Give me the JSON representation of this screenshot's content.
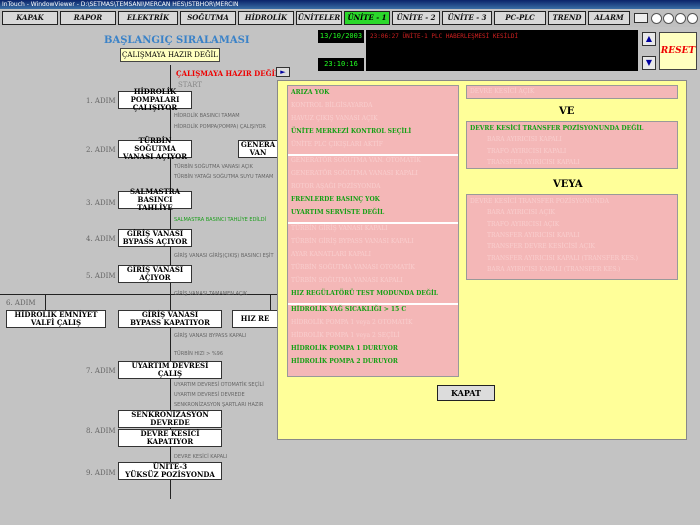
{
  "window": {
    "title": "InTouch - WindowViewer - D:\\SETMAS\\TEMSANI\\MERCAN HES\\ISTBHOR\\MERCIN"
  },
  "nav": {
    "items": [
      "KAPAK",
      "RAPOR",
      "ELEKTRİK",
      "SOĞUTMA",
      "HİDROLİK",
      "ÜNİTELER",
      "ÜNİTE - 1",
      "ÜNİTE - 2",
      "ÜNİTE - 3",
      "PC-PLC",
      "TREND",
      "ALARM"
    ],
    "active": "ÜNİTE - 1",
    "printer_icon": "printer-icon",
    "circle_count": 4
  },
  "header": {
    "date": "13/10/2003",
    "time": "23:10:16",
    "alarm_text": "23:06:27 ÜNİTE-1 PLC HABERLEŞMESİ KESİLDİ",
    "reset_label": "RESET",
    "scroll_up": "▲",
    "scroll_down": "▼"
  },
  "sequence": {
    "title": "BAŞLANGIÇ SIRALAMASI",
    "status_box": "ÇALIŞMAYA HAZIR DEĞİL",
    "status_red": "ÇALIŞMAYA HAZIR DEĞİL",
    "start_label": "START",
    "arrow": "►",
    "steps": [
      {
        "label": "1. ADIM",
        "box": "HİDROLİK POMPALARI\nÇALIŞIYOR"
      },
      {
        "label": "2. ADIM",
        "box": "TÜRBİN SOĞUTMA\nVANASI AÇIYOR",
        "box2": "GENERA\nVAN"
      },
      {
        "label": "3. ADIM",
        "box": "SALMASTRA\nBASINCI TAHLİYE"
      },
      {
        "label": "4. ADIM",
        "box": "GİRİŞ VANASI\nBYPASS AÇIYOR"
      },
      {
        "label": "5. ADIM",
        "box": "GİRİŞ VANASI\nAÇIYOR"
      },
      {
        "label": "6. ADIM",
        "box": "HİDROLİK EMNİYET\nVALFİ ÇALIŞ",
        "box2": "GİRİŞ VANASI\nBYPASS KAPATIYOR",
        "box3": "HIZ RE"
      },
      {
        "label": "7. ADIM",
        "box": "UYARTIM DEVRESİ\nÇALIŞ"
      },
      {
        "label": "8. ADIM",
        "box": "SENKRONİZASYON\nDEVREDE",
        "box2": "DEVRE KESİCİ\nKAPATIYOR"
      },
      {
        "label": "9. ADIM",
        "box": "ÜNİTE-3\nYÜKSÜZ POZİSYONDA"
      }
    ],
    "notes": {
      "n1a": "HİDROLİK BASINCI TAMAM",
      "n1b": "HİDROLİK POMPA(POMPA) ÇALIŞIYOR",
      "n2a": "TÜRBİN SOĞUTMA VANASI AÇIK",
      "n2b": "TÜRBİN YATAĞI SOĞUTMA SUYU TAMAM",
      "n3": "SALMASTRA BASINCI TAHLİYE EDİLDİ",
      "n4": "GİRİŞ VANASI GİRİŞ(ÇIKIŞ) BASINCI EŞİT",
      "n5": "GİRİŞ VANASI TAMAMEN AÇIK",
      "n6": "GİRİŞ VANASI BYPASS KAPALI",
      "n6b": "TÜRBİN HIZI > %96",
      "n7a": "UYARTIM DEVRESİ OTOMATİK SEÇİLİ",
      "n7b": "UYARTIM DEVRESİ DEVREDE",
      "n7c": "SENKRONİZASYON ŞARTLARI HAZIR",
      "n8": "DEVRE KESİCİ KAPALI"
    }
  },
  "popup": {
    "left_groups": [
      [
        {
          "text": "ARIZA YOK",
          "on": true
        },
        {
          "text": "KONTROL BİLGİSAYARDA",
          "on": false
        },
        {
          "text": "HAVUZ ÇIKIŞ VANASI AÇIK",
          "on": false
        },
        {
          "text": "ÜNİTE MERKEZİ KONTROL SEÇİLİ",
          "on": true
        },
        {
          "text": "ÜNİTE PLC ÇIKIŞLARI AKTİF",
          "on": false
        }
      ],
      [
        {
          "text": "GENERATÖR SOĞUTMA VAN. OTOMATİK",
          "on": false
        },
        {
          "text": "GENERATÖR SOĞUTMA VANASI KAPALI",
          "on": false
        },
        {
          "text": "ROTOR AŞAĞI POZİSYONDA",
          "on": false
        },
        {
          "text": "FRENLERDE BASINÇ YOK",
          "on": true
        },
        {
          "text": "UYARTIM SERVİSTE DEĞİL",
          "on": true
        }
      ],
      [
        {
          "text": "TÜRBİN GİRİŞ VANASI KAPALI",
          "on": false
        },
        {
          "text": "TÜRBİN GİRİŞ BYPASS VANASI KAPALI",
          "on": false
        },
        {
          "text": "AYAR KANATLARI KAPALI",
          "on": false
        },
        {
          "text": "TÜRBİN SOĞUTMA VANASI OTOMATİK",
          "on": false
        },
        {
          "text": "TÜRBİN SOĞUTMA VANASI KAPALI",
          "on": false
        },
        {
          "text": "HIZ REGÜLATÖRÜ TEST MODUNDA DEĞİL",
          "on": true
        }
      ],
      [
        {
          "text": "HİDROLİK YAĞ SICAKLIĞI > 15 C",
          "on": true
        },
        {
          "text": "HİDROLİK POMPA 1 veya 2 OTOMATİK",
          "on": false
        },
        {
          "text": "HİDROLİK POMPA 1 veya 2 SEÇİLİ",
          "on": false
        },
        {
          "text": "HİDROLİK POMPA 1 DURUYOR",
          "on": true
        },
        {
          "text": "HİDROLİK POMPA 2 DURUYOR",
          "on": true
        }
      ]
    ],
    "right_top": "DEVRE KESİCİ AÇIK",
    "ve": "VE",
    "veya": "VEYA",
    "right_group1": [
      {
        "text": "DEVRE KESİCİ TRANSFER POZİSYONUNDA DEĞİL",
        "on": true,
        "indent": false
      },
      {
        "text": "BARA AYIRICISI KAPALI",
        "on": false,
        "indent": true
      },
      {
        "text": "TRAFO AYIRICISI KAPALI",
        "on": false,
        "indent": true
      },
      {
        "text": "TRANSFER AYIRICISI KAPALI",
        "on": false,
        "indent": true
      }
    ],
    "right_group2": [
      {
        "text": "DEVRE KESİCİ TRANSFER POZİSYONUNDA",
        "on": false,
        "indent": false
      },
      {
        "text": "BARA AYIRICISI AÇIK",
        "on": false,
        "indent": true
      },
      {
        "text": "TRAFO AYIRICISI AÇIK",
        "on": false,
        "indent": true
      },
      {
        "text": "TRANSFER AYIRICISI KAPALI",
        "on": false,
        "indent": true
      },
      {
        "text": "TRANSFER DEVRE KESİCİSİ AÇIK",
        "on": false,
        "indent": true
      },
      {
        "text": "TRANSFER AYIRICISI KAPALI (TRANSFER KES.)",
        "on": false,
        "indent": true
      },
      {
        "text": "BARA AYIRICISI KAPALI (TRANSFER KES.)",
        "on": false,
        "indent": true
      }
    ],
    "close_label": "KAPAT"
  },
  "colors": {
    "active_nav": "#2bd82b",
    "popup_bg": "#ffff99",
    "panel_bg": "#f4b7b7",
    "ok_green": "#14a014",
    "alarm_red": "#d02020"
  }
}
